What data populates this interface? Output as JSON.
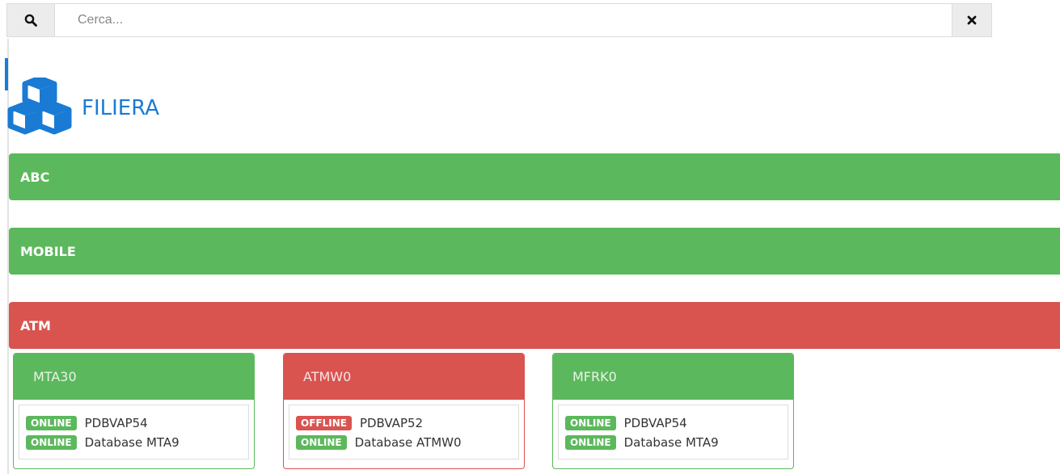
{
  "search": {
    "placeholder": "Cerca...",
    "value": "",
    "search_icon": "search-icon",
    "clear_icon": "close-icon"
  },
  "page": {
    "title": "FILIERA",
    "logo_icon": "cubes-icon",
    "accent_color": "#1a7bd4"
  },
  "groups": [
    {
      "label": "ABC",
      "status": "green"
    },
    {
      "label": "MOBILE",
      "status": "green"
    },
    {
      "label": "ATM",
      "status": "red"
    }
  ],
  "cards": [
    {
      "title": "MTA30",
      "status": "green",
      "items": [
        {
          "badge": "ONLINE",
          "label": "PDBVAP54"
        },
        {
          "badge": "ONLINE",
          "label": "Database MTA9"
        }
      ]
    },
    {
      "title": "ATMW0",
      "status": "red",
      "items": [
        {
          "badge": "OFFLINE",
          "label": "PDBVAP52"
        },
        {
          "badge": "ONLINE",
          "label": "Database ATMW0"
        }
      ]
    },
    {
      "title": "MFRK0",
      "status": "green",
      "items": [
        {
          "badge": "ONLINE",
          "label": "PDBVAP54"
        },
        {
          "badge": "ONLINE",
          "label": "Database MTA9"
        }
      ]
    }
  ],
  "colors": {
    "success": "#5cb85c",
    "danger": "#d9534f"
  }
}
